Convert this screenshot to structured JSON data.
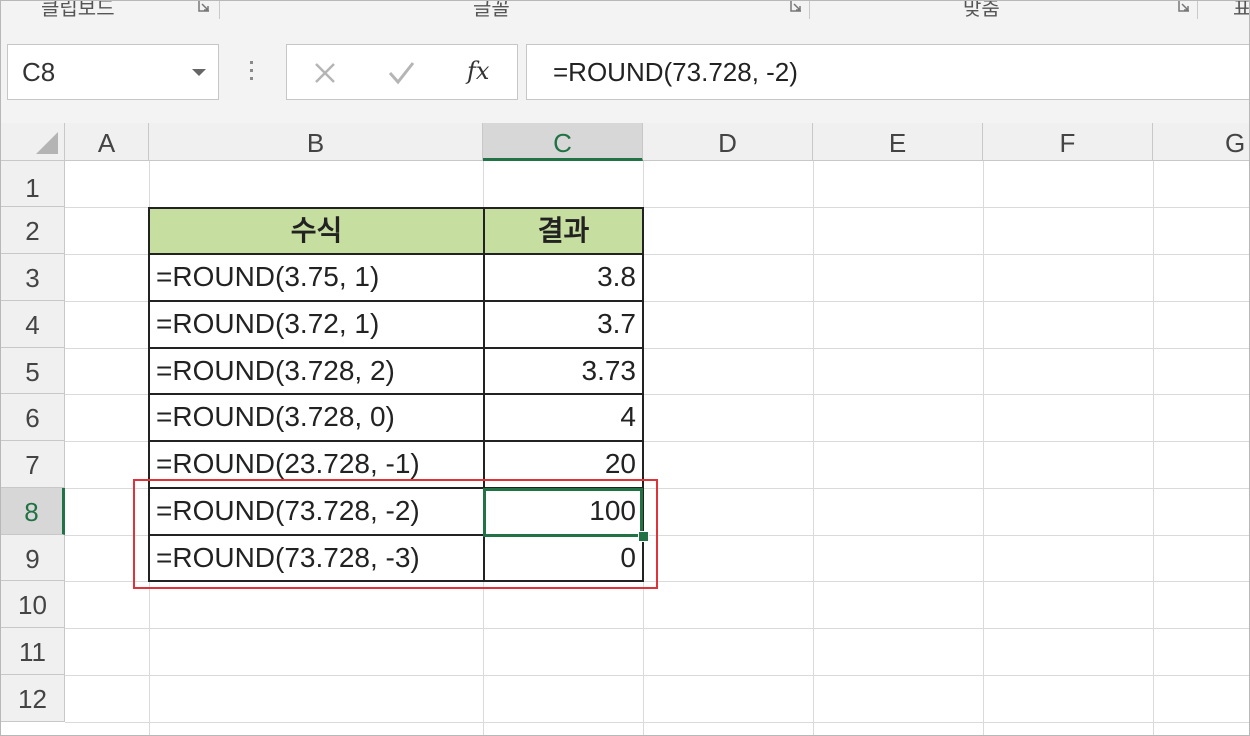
{
  "ribbon": {
    "groups": [
      {
        "label": "클립보드"
      },
      {
        "label": "글꼴"
      },
      {
        "label": "맞춤"
      },
      {
        "label": "표"
      }
    ]
  },
  "formula_bar": {
    "name_box": "C8",
    "cancel_icon": "x-icon",
    "enter_icon": "check-icon",
    "fx_label": "fx",
    "formula": "=ROUND(73.728, -2)"
  },
  "grid": {
    "columns": [
      "A",
      "B",
      "C",
      "D",
      "E",
      "F",
      "G"
    ],
    "rows": [
      "1",
      "2",
      "3",
      "4",
      "5",
      "6",
      "7",
      "8",
      "9",
      "10",
      "11",
      "12"
    ],
    "active_cell": "C8",
    "accent_color": "#217346",
    "header_fill_color": "#c6dfa0",
    "highlight_color": "#e0323a"
  },
  "table": {
    "header": {
      "formula": "수식",
      "result": "결과"
    },
    "rows": [
      {
        "formula": "=ROUND(3.75, 1)",
        "result": "3.8"
      },
      {
        "formula": "=ROUND(3.72, 1)",
        "result": "3.7"
      },
      {
        "formula": "=ROUND(3.728, 2)",
        "result": "3.73"
      },
      {
        "formula": "=ROUND(3.728, 0)",
        "result": "4"
      },
      {
        "formula": "=ROUND(23.728, -1)",
        "result": "20"
      },
      {
        "formula": "=ROUND(73.728, -2)",
        "result": "100"
      },
      {
        "formula": "=ROUND(73.728, -3)",
        "result": "0"
      }
    ]
  }
}
